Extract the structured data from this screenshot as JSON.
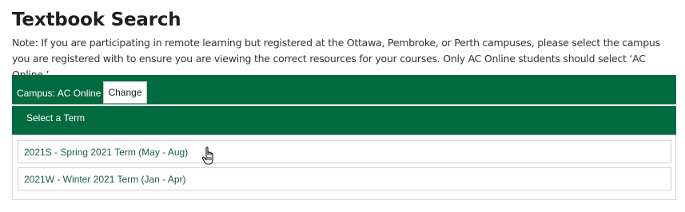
{
  "page": {
    "title": "Textbook Search",
    "note": "Note: If you are participating in remote learning but registered at the Ottawa, Pembroke, or Perth campuses, please select the campus you are registered with to ensure you are viewing the correct resources for your courses. Only AC Online students should select ‘AC Online.’"
  },
  "campus": {
    "label": "Campus: AC Online",
    "change_label": "Change"
  },
  "terms": {
    "header": "Select a Term",
    "items": [
      {
        "label": "2021S - Spring 2021 Term (May - Aug)"
      },
      {
        "label": "2021W - Winter 2021 Term (Jan - Apr)"
      }
    ]
  },
  "colors": {
    "brand_green": "#006a41",
    "term_text": "#1b5e3f"
  },
  "cursor": {
    "icon": "hand-pointer-icon"
  }
}
